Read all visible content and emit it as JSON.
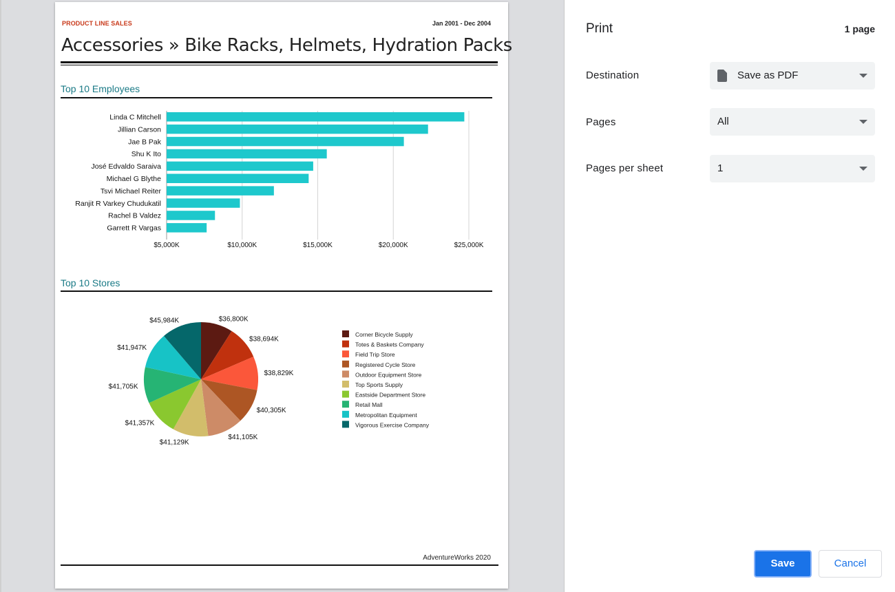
{
  "report": {
    "tag": "PRODUCT LINE SALES",
    "date_range": "Jan 2001 - Dec 2004",
    "title": "Accessories » Bike Racks, Helmets, Hydration Packs",
    "section_employees": "Top 10 Employees",
    "section_stores": "Top 10 Stores",
    "footer": "AdventureWorks 2020"
  },
  "dialog": {
    "title": "Print",
    "page_count": "1 page",
    "destination_label": "Destination",
    "destination_value": "Save as PDF",
    "pages_label": "Pages",
    "pages_value": "All",
    "pages_per_sheet_label": "Pages per sheet",
    "pages_per_sheet_value": "1",
    "save_label": "Save",
    "cancel_label": "Cancel"
  },
  "colors": {
    "bar": "#1ec8cc",
    "accent_blue": "#1a73e8",
    "section_teal": "#1a7a86",
    "tag_red": "#c8391a"
  },
  "chart_data": [
    {
      "type": "bar",
      "orientation": "horizontal",
      "categories": [
        "Linda C Mitchell",
        "Jillian  Carson",
        "Jae B Pak",
        "Shu K Ito",
        "José Edvaldo Saraiva",
        "Michael G Blythe",
        "Tsvi Michael Reiter",
        "Ranjit R Varkey Chudukatil",
        "Rachel B Valdez",
        "Garrett R Vargas"
      ],
      "values": [
        24700,
        22300,
        20700,
        15600,
        14700,
        14400,
        12100,
        9850,
        8200,
        7650
      ],
      "x_ticks": [
        "$5,000K",
        "$10,000K",
        "$15,000K",
        "$20,000K",
        "$25,000K"
      ],
      "x_tick_values": [
        5000,
        10000,
        15000,
        20000,
        25000
      ],
      "xlim": [
        5000,
        25000
      ],
      "grid": true
    },
    {
      "type": "pie",
      "labels": [
        "Corner Bicycle Supply",
        "Totes & Baskets Company",
        "Field Trip Store",
        "Registered Cycle Store",
        "Outdoor Equipment Store",
        "Top Sports Supply",
        "Eastside Department Store",
        "Retail Mall",
        "Metropolitan Equipment",
        "Vigorous Exercise Company"
      ],
      "values": [
        36800,
        38694,
        38829,
        40305,
        41105,
        41129,
        41357,
        41705,
        41947,
        45984
      ],
      "value_labels": [
        "$36,800K",
        "$38,694K",
        "$38,829K",
        "$40,305K",
        "$41,105K",
        "$41,129K",
        "$41,357K",
        "$41,705K",
        "$41,947K",
        "$45,984K"
      ],
      "colors": [
        "#5c1a12",
        "#c0310e",
        "#fb573a",
        "#ad5624",
        "#cd8b67",
        "#d2bd6b",
        "#8ac82f",
        "#26b474",
        "#17c3c6",
        "#05676a"
      ],
      "legend": "right"
    }
  ]
}
